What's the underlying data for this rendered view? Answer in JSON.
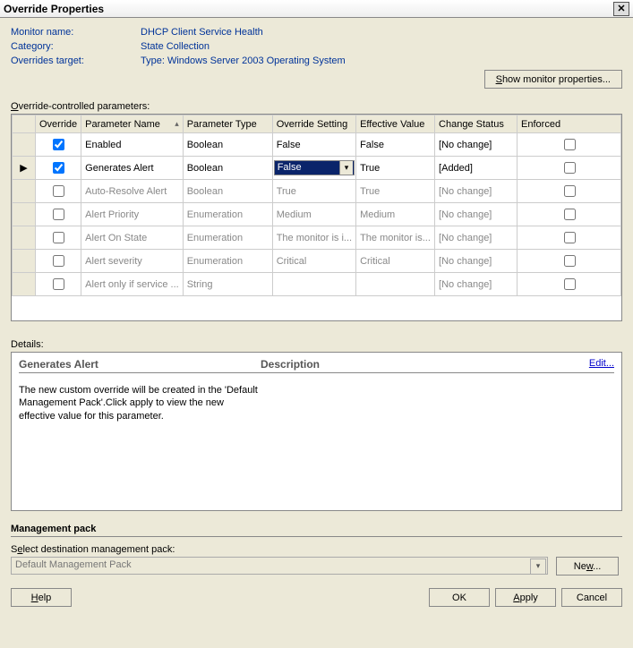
{
  "title": "Override Properties",
  "info": {
    "monitor_name_label": "Monitor name:",
    "monitor_name": "DHCP Client Service Health",
    "category_label": "Category:",
    "category": "State Collection",
    "target_label": "Overrides target:",
    "target": "Type: Windows Server 2003 Operating System"
  },
  "labels": {
    "params_section_html": "<span class='u'>O</span>verride-controlled parameters:",
    "show_monitor_btn_html": "<span class='u'>S</span>how monitor properties...",
    "details_label": "Details:",
    "mp_heading": "Management pack",
    "mp_select_label_html": "S<span class='u'>e</span>lect destination management pack:",
    "mp_selected": "Default Management Pack",
    "new_btn_html": "Ne<span class='u'>w</span>...",
    "help_btn_html": "<span class='u'>H</span>elp",
    "ok_btn": "OK",
    "apply_btn_html": "<span class='u'>A</span>pply",
    "cancel_btn": "Cancel",
    "edit_link": "Edit..."
  },
  "columns": {
    "override": "Override",
    "name": "Parameter Name",
    "type": "Parameter Type",
    "setting": "Override Setting",
    "eff": "Effective Value",
    "chg": "Change Status",
    "enf": "Enforced"
  },
  "rows": [
    {
      "sel": false,
      "override": true,
      "name": "Enabled",
      "type": "Boolean",
      "setting": "False",
      "eff": "False",
      "chg": "[No change]",
      "enf": false,
      "disabled": false,
      "editing": false
    },
    {
      "sel": true,
      "override": true,
      "name": "Generates Alert",
      "type": "Boolean",
      "setting": "False",
      "eff": "True",
      "chg": "[Added]",
      "enf": false,
      "disabled": false,
      "editing": true
    },
    {
      "sel": false,
      "override": false,
      "name": "Auto-Resolve Alert",
      "type": "Boolean",
      "setting": "True",
      "eff": "True",
      "chg": "[No change]",
      "enf": false,
      "disabled": true,
      "editing": false
    },
    {
      "sel": false,
      "override": false,
      "name": "Alert Priority",
      "type": "Enumeration",
      "setting": "Medium",
      "eff": "Medium",
      "chg": "[No change]",
      "enf": false,
      "disabled": true,
      "editing": false
    },
    {
      "sel": false,
      "override": false,
      "name": "Alert On State",
      "type": "Enumeration",
      "setting": "The monitor is i...",
      "eff": "The monitor is...",
      "chg": "[No change]",
      "enf": false,
      "disabled": true,
      "editing": false
    },
    {
      "sel": false,
      "override": false,
      "name": "Alert severity",
      "type": "Enumeration",
      "setting": "Critical",
      "eff": "Critical",
      "chg": "[No change]",
      "enf": false,
      "disabled": true,
      "editing": false
    },
    {
      "sel": false,
      "override": false,
      "name": "Alert only if service ...",
      "type": "String",
      "setting": "",
      "eff": "",
      "chg": "[No change]",
      "enf": false,
      "disabled": true,
      "editing": false
    }
  ],
  "details": {
    "name": "Generates Alert",
    "body": "The new custom override will be created in the 'Default Management Pack'.Click apply to view the new effective value for this parameter.",
    "desc_heading": "Description"
  }
}
